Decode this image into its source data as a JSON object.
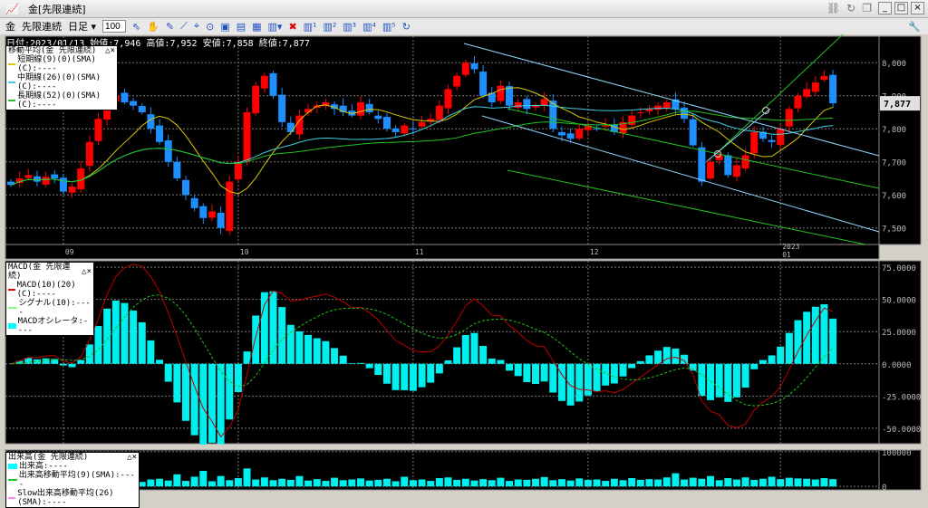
{
  "window": {
    "title": "金[先限連続]"
  },
  "toolbar": {
    "symbol": "金",
    "contract": "先限連続",
    "period": "日足",
    "count": "100"
  },
  "info": {
    "date": "日付:2023/01/13",
    "open": "始値:7,946",
    "high": "高値:7,952",
    "low": "安値:7,858",
    "close": "終値:7,877"
  },
  "price_legend": {
    "title": "移動平均(金 先限連続)",
    "items": [
      "短期線(9)(0)(SMA)(C):----",
      "中期線(26)(0)(SMA)(C):----",
      "長期線(52)(0)(SMA)(C):----"
    ]
  },
  "macd_legend": {
    "title": "MACD(金 先限連続)",
    "items": [
      "MACD(10)(20)(C):----",
      "シグナル(10):----",
      "MACDオシレータ:----"
    ]
  },
  "vol_legend": {
    "title": "出来高(金 先限連続)",
    "items": [
      "出来高:----",
      "出来高移動平均(9)(SMA):----",
      "Slow出来高移動平均(26)(SMA):----"
    ]
  },
  "colors": {
    "up": "#ff0000",
    "down": "#1e8fff",
    "ma9": "#d8c800",
    "ma26": "#40d0e0",
    "ma52": "#20c020",
    "hist": "#00f0f0",
    "macd": "#c00000",
    "signal": "#20c020"
  },
  "chart_data": [
    {
      "type": "candlestick",
      "title": "金[先限連続] 日足",
      "ylim": [
        7450,
        8080
      ],
      "yticks": [
        "8,000",
        "7,900",
        "7,800",
        "7,700",
        "7,600",
        "7,500"
      ],
      "ytick_values": [
        8000,
        7900,
        7800,
        7700,
        7600,
        7500
      ],
      "current": "7,877",
      "xticks": [
        "09",
        "10",
        "11",
        "12",
        "2023\n01"
      ],
      "xtick_index": [
        6,
        26,
        46,
        66,
        88
      ],
      "close": [
        7630,
        7650,
        7660,
        7640,
        7655,
        7650,
        7610,
        7625,
        7680,
        7760,
        7830,
        7890,
        7900,
        7880,
        7870,
        7850,
        7800,
        7760,
        7700,
        7650,
        7600,
        7560,
        7530,
        7550,
        7500,
        7640,
        7700,
        7850,
        7930,
        7960,
        7900,
        7820,
        7790,
        7840,
        7860,
        7870,
        7880,
        7860,
        7850,
        7840,
        7880,
        7850,
        7830,
        7800,
        7790,
        7810,
        7800,
        7820,
        7830,
        7870,
        7920,
        7960,
        8000,
        7980,
        7900,
        7880,
        7930,
        7870,
        7880,
        7860,
        7870,
        7890,
        7800,
        7780,
        7770,
        7800,
        7810,
        7800,
        7810,
        7790,
        7820,
        7840,
        7850,
        7860,
        7870,
        7880,
        7860,
        7830,
        7750,
        7640,
        7700,
        7720,
        7660,
        7690,
        7720,
        7790,
        7770,
        7760,
        7800,
        7860,
        7900,
        7920,
        7940,
        7960,
        7877
      ]
    },
    {
      "type": "bar+line",
      "title": "MACD",
      "ylim": [
        -62,
        80
      ],
      "yticks": [
        "75.0000",
        "50.0000",
        "25.0000",
        "0.0000",
        "-25.0000",
        "-50.0000"
      ],
      "ytick_values": [
        75,
        50,
        25,
        0,
        -25,
        -50
      ]
    },
    {
      "type": "bar",
      "title": "出来高",
      "ylim": [
        -10000,
        105000
      ],
      "yticks": [
        "100000",
        "0"
      ],
      "ytick_values": [
        100000,
        0
      ],
      "volume": [
        18000,
        15000,
        22000,
        12000,
        20000,
        17000,
        25000,
        14000,
        19000,
        30000,
        16000,
        21000,
        18000,
        15000,
        26000,
        13000,
        20000,
        22000,
        17000,
        35000,
        16000,
        28000,
        45000,
        15000,
        30000,
        18000,
        24000,
        52000,
        20000,
        26000,
        18000,
        22000,
        19000,
        30000,
        17000,
        21000,
        16000,
        25000,
        18000,
        20000,
        23000,
        17000,
        19000,
        22000,
        15000,
        28000,
        18000,
        20000,
        16000,
        24000,
        26000,
        19000,
        22000,
        17000,
        21000,
        18000,
        25000,
        16000,
        20000,
        19000,
        22000,
        27000,
        18000,
        21000,
        17000,
        23000,
        19000,
        20000,
        16000,
        22000,
        18000,
        24000,
        19000,
        21000,
        20000,
        26000,
        38000,
        20000,
        25000,
        22000,
        30000,
        18000,
        24000,
        20000,
        26000,
        19000,
        22000,
        28000,
        21000,
        25000,
        23000,
        22000,
        20000,
        24000,
        21000
      ]
    }
  ]
}
